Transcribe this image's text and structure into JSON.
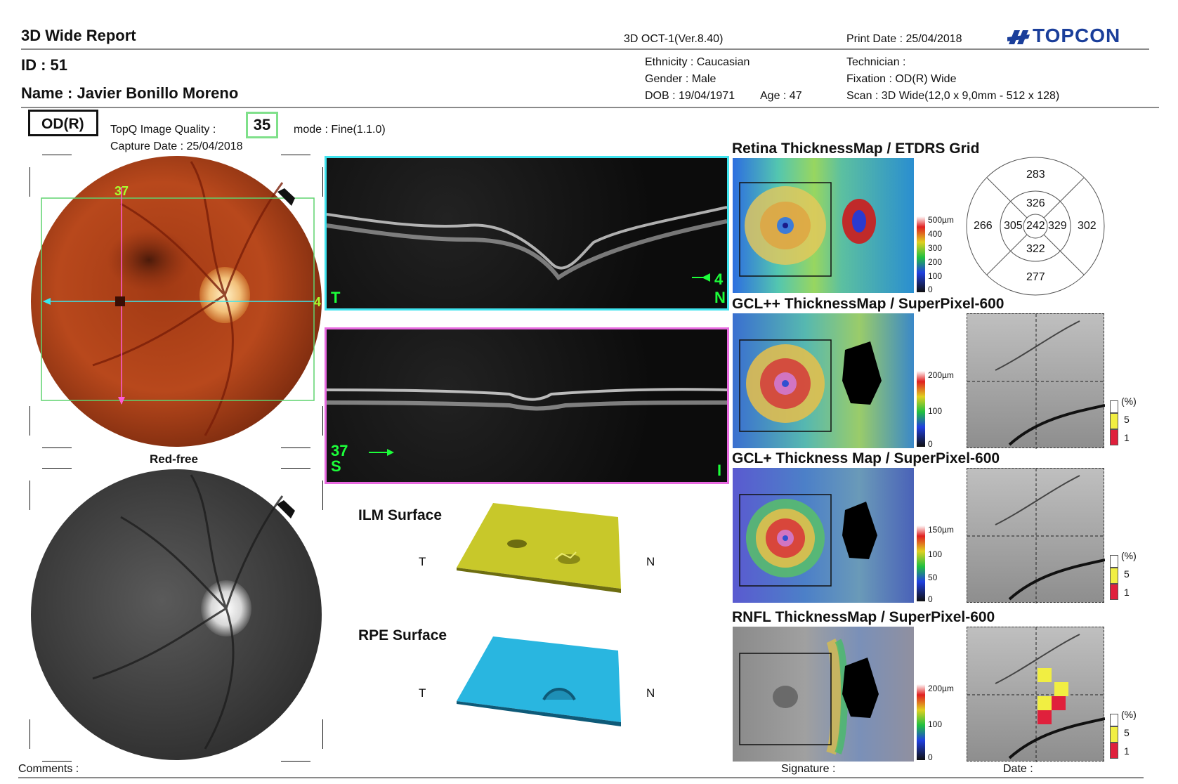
{
  "header": {
    "report_title": "3D Wide Report",
    "device": "3D OCT-1(Ver.8.40)",
    "print_date": "Print Date : 25/04/2018",
    "brand": "TOPCON",
    "id": "ID : 51",
    "name": "Name : Javier Bonillo Moreno",
    "ethnicity": "Ethnicity : Caucasian",
    "gender": "Gender : Male",
    "dob": "DOB : 19/04/1971",
    "age": "Age : 47",
    "technician": "Technician :",
    "fixation": "Fixation : OD(R) Wide",
    "scan": "Scan : 3D Wide(12,0 x 9,0mm - 512 x 128)"
  },
  "exam": {
    "eye": "OD(R)",
    "topq_label": "TopQ Image Quality :",
    "topq_value": "35",
    "mode": "mode : Fine(1.1.0)",
    "capture_date": "Capture Date : 25/04/2018"
  },
  "fundus": {
    "scan_number": "37",
    "line_number": "4",
    "redfree_label": "Red-free"
  },
  "bscan1": {
    "left": "T",
    "right": "N",
    "number": "4"
  },
  "bscan2": {
    "left": "S",
    "right": "I",
    "number": "37"
  },
  "surfaces": {
    "ilm_label": "ILM Surface",
    "rpe_label": "RPE Surface",
    "left": "T",
    "right": "N",
    "ilm_color": "#c8c82a",
    "rpe_color": "#29b6e0"
  },
  "maps": {
    "retina_title": "Retina ThicknessMap / ETDRS Grid",
    "gclpp_title": "GCL++ ThicknessMap / SuperPixel-600",
    "gclp_title": "GCL+ Thickness Map / SuperPixel-600",
    "rnfl_title": "RNFL ThicknessMap / SuperPixel-600",
    "retina_scale": [
      "500µm",
      "400",
      "300",
      "200",
      "100",
      "0"
    ],
    "gclpp_scale": [
      "200µm",
      "100",
      "0"
    ],
    "gclp_scale": [
      "150µm",
      "100",
      "50",
      "0"
    ],
    "rnfl_scale": [
      "200µm",
      "100",
      "0"
    ],
    "percent_legend": {
      "label": "(%)",
      "five": "5",
      "one": "1"
    }
  },
  "etdrs": {
    "superior_outer": "283",
    "superior_inner": "326",
    "temporal_outer": "266",
    "temporal_inner": "305",
    "center": "242",
    "nasal_inner": "329",
    "nasal_outer": "302",
    "inferior_inner": "322",
    "inferior_outer": "277"
  },
  "footer": {
    "comments": "Comments :",
    "signature": "Signature :",
    "date": "Date :"
  }
}
